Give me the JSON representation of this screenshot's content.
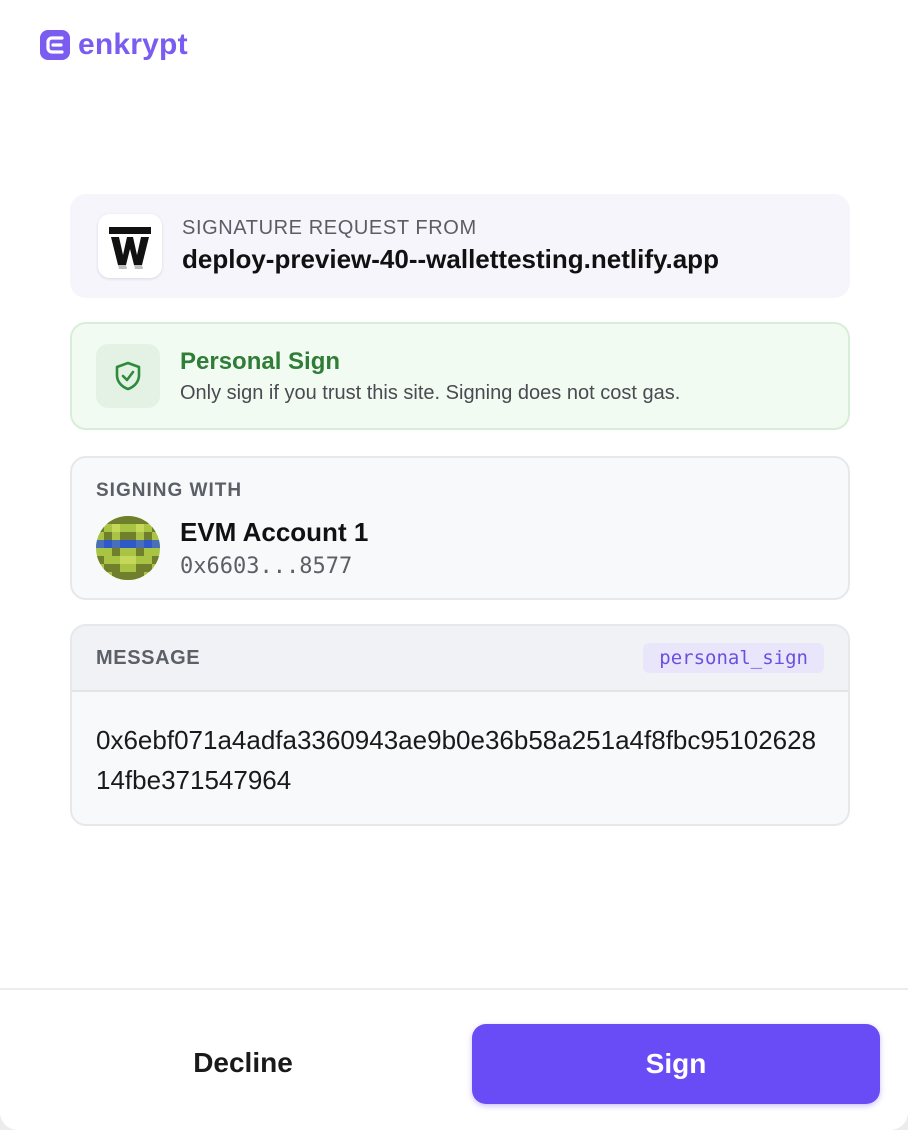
{
  "brand": {
    "name": "enkrypt",
    "color": "#7b5cf0"
  },
  "request": {
    "label": "SIGNATURE REQUEST FROM",
    "domain": "deploy-preview-40--wallettesting.netlify.app",
    "favicon_icon": "site-w-logo-icon"
  },
  "notice": {
    "title": "Personal Sign",
    "description": "Only sign if you trust this site. Signing does not cost gas.",
    "icon": "shield-check-icon",
    "color": "#2f7d37"
  },
  "account": {
    "section_label": "SIGNING WITH",
    "name": "EVM Account 1",
    "address": "0x6603...8577"
  },
  "message": {
    "section_label": "MESSAGE",
    "method": "personal_sign",
    "body": "0x6ebf071a4adfa3360943ae9b0e36b58a251a4f8fbc9510262814fbe371547964"
  },
  "actions": {
    "decline_label": "Decline",
    "sign_label": "Sign",
    "sign_color": "#6a4cf6"
  }
}
